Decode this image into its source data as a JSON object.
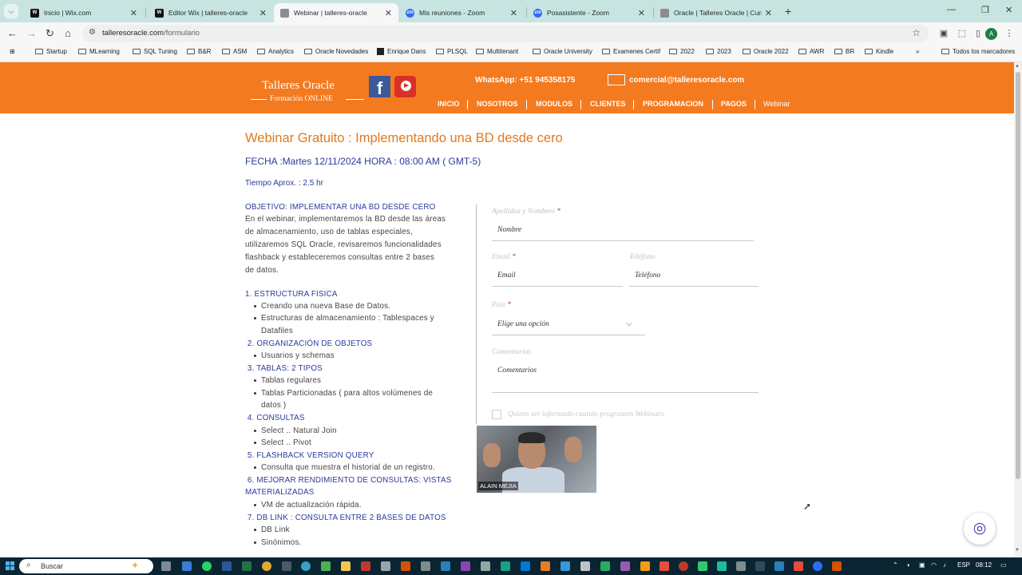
{
  "browser": {
    "tabs": [
      {
        "title": "Inicio | Wix.com",
        "favicon": "Wix",
        "active": false
      },
      {
        "title": "Editor Wix | talleres-oracle",
        "favicon": "Wix",
        "active": false
      },
      {
        "title": "Webinar | talleres-oracle",
        "favicon": "site",
        "active": true
      },
      {
        "title": "Mis reuniones - Zoom",
        "favicon": "zm",
        "active": false
      },
      {
        "title": "Posasistente - Zoom",
        "favicon": "zm",
        "active": false
      },
      {
        "title": "Oracle | Talleres Oracle | Cursos",
        "favicon": "site",
        "active": false
      }
    ],
    "url_host": "talleresoracle.com",
    "url_path": "/formulario",
    "profile_initial": "A",
    "bookmarks": [
      "Startup",
      "MLearning",
      "SQL Tuning",
      "B&R",
      "ASM",
      "Analytics",
      "Oracle Novedades",
      "Enrique Dans",
      "PLSQL",
      "Multitenant",
      "Oracle University",
      "Examenes Certif",
      "2022",
      "2023",
      "Oracle 2022",
      "AWR",
      "BR",
      "Kindle"
    ],
    "bookmarks_more": "»",
    "all_bookmarks": "Todos los marcadores"
  },
  "site": {
    "logo_title": "Talleres Oracle",
    "logo_subtitle": "Formación ONLINE",
    "whatsapp": "WhatsApp:  +51 945358175",
    "email": "comercial@talleresoracle.com",
    "nav": [
      "INICIO",
      "NOSOTROS",
      "MODULOS",
      "CLIENTES",
      "PROGRAMACION",
      "PAGOS",
      "Webinar"
    ]
  },
  "page": {
    "title": "Webinar Gratuito : Implementando una BD desde cero",
    "date": "FECHA :Martes 12/11/2024 HORA : 08:00 AM ( GMT-5)",
    "duration": "Tiempo Aprox. : 2.5 hr",
    "objective_heading": "OBJETIVO: IMPLEMENTAR UNA BD DESDE CERO",
    "objective_lines": [
      "En el webinar, implementaremos la BD desde las áreas",
      "de almacenamiento, uso de tablas especiales,",
      "utilizaremos SQL Oracle, revisaremos funcionalidades",
      "flashback y estableceremos consultas entre 2 bases",
      "de datos."
    ],
    "sections": [
      {
        "heading": "1. ESTRUCTURA FISICA",
        "items": [
          "Creando una nueva Base de Datos.",
          "Estructuras de almacenamiento : Tablespaces y",
          "Datafiles"
        ]
      },
      {
        "heading": " 2. ORGANIZACIÓN DE OBJETOS",
        "items": [
          "Usuarios y schemas"
        ]
      },
      {
        "heading": " 3. TABLAS: 2 TIPOS",
        "items": [
          "Tablas regulares",
          "Tablas Particionadas ( para altos volúmenes de",
          "datos )"
        ]
      },
      {
        "heading": " 4. CONSULTAS",
        "items": [
          "Select .. Natural Join",
          "Select .. Pivot"
        ]
      },
      {
        "heading": " 5. FLASHBACK VERSION QUERY",
        "items": [
          "Consulta que muestra el historial de un registro."
        ]
      },
      {
        "heading": " 6. MEJORAR RENDIMIENTO DE CONSULTAS: VISTAS",
        "heading2": "MATERIALIZADAS",
        "items": [
          "VM de actualización rápida."
        ]
      },
      {
        "heading": " 7. DB LINK : CONSULTA ENTRE 2 BASES DE DATOS",
        "items": [
          "DB Link",
          "Sinónimos."
        ]
      }
    ]
  },
  "form": {
    "name_label": "Apellidos y Nombres",
    "name_placeholder": "Nombre",
    "email_label": "Email",
    "email_placeholder": "Email",
    "phone_label": "Teléfono",
    "phone_placeholder": "Teléfono",
    "country_label": "País",
    "country_value": "Elige una opción",
    "comments_label": "Comentarios",
    "comments_placeholder": "Comentarios",
    "required_mark": "*",
    "subscribe_label": "Quiero ser informado cuando programen Webinars."
  },
  "video": {
    "participant": "ALAIN MEJIA"
  },
  "taskbar": {
    "search": "Buscar",
    "lang": "ESP",
    "time": "08:12"
  },
  "colors": {
    "brand_orange": "#f47a20",
    "heading_blue": "#2b3a9b",
    "title_orange": "#e07a1e"
  }
}
